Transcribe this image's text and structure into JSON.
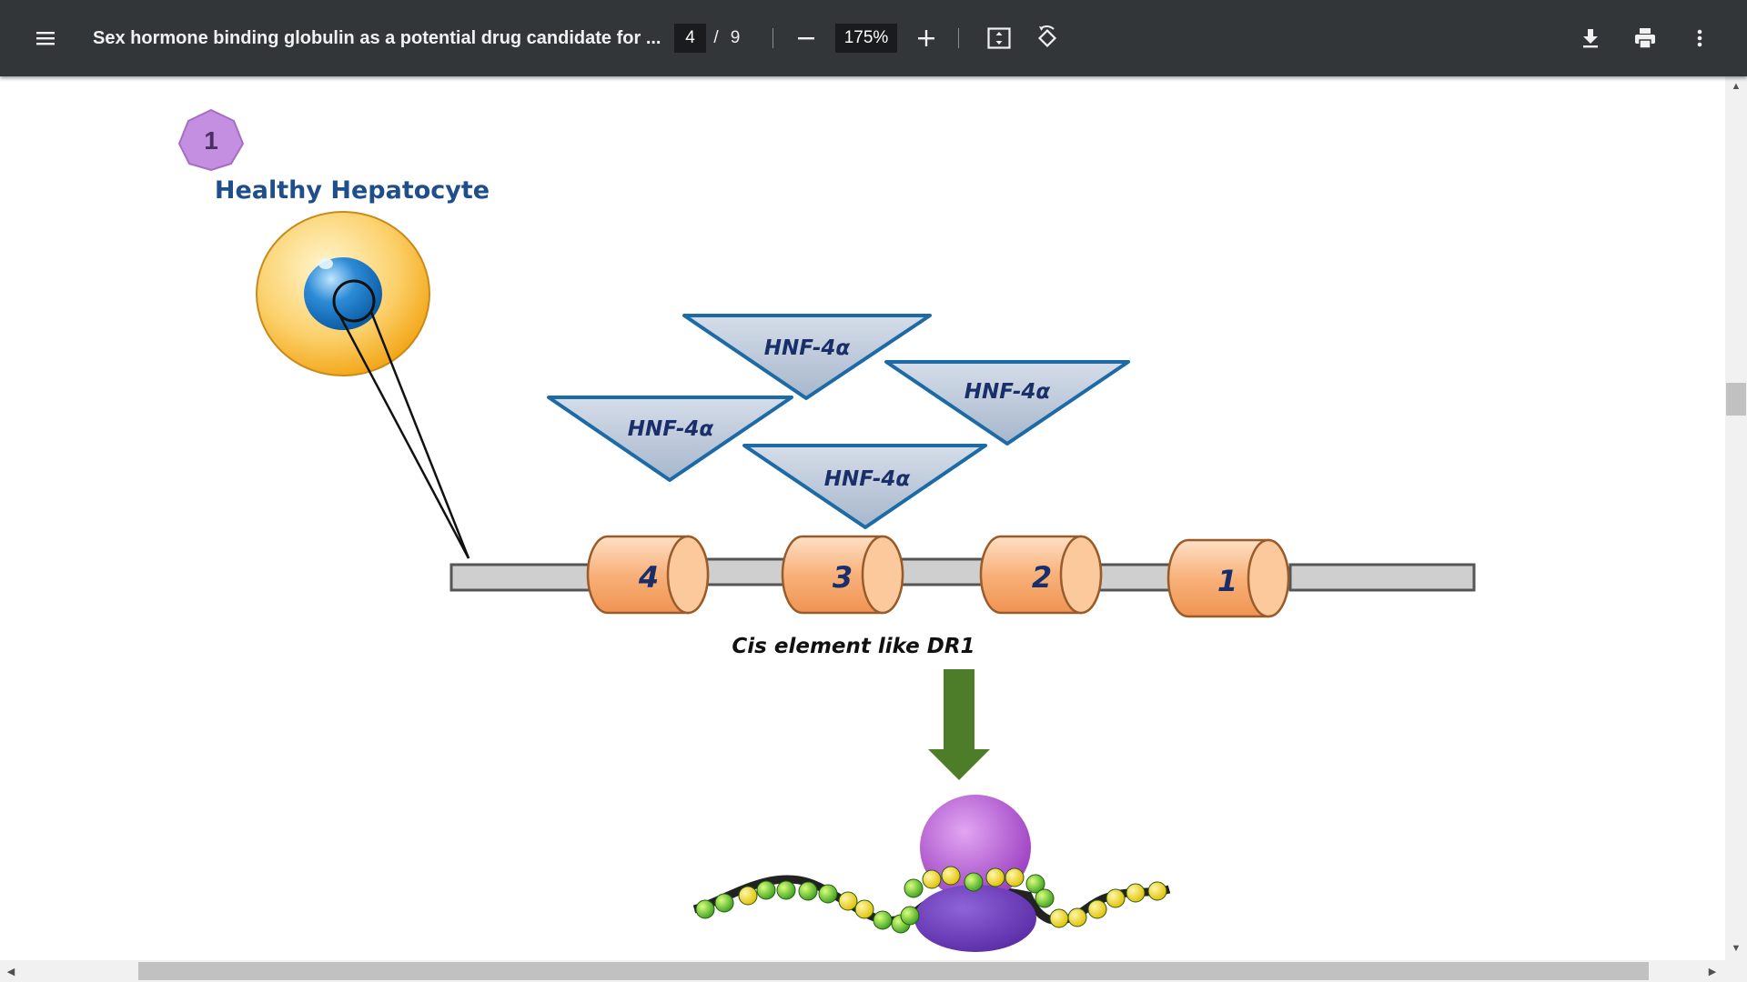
{
  "toolbar": {
    "menu_icon": "hamburger-menu-icon",
    "title": "Sex hormone binding globulin as a potential drug candidate for ...",
    "page_current": "4",
    "page_separator": "/",
    "page_total": "9",
    "zoom": "175%",
    "icons": [
      "zoom-out-icon",
      "zoom-in-icon",
      "fit-to-page-icon",
      "rotate-icon",
      "download-icon",
      "print-icon",
      "more-vert-icon"
    ]
  },
  "figure": {
    "step_badge": "1",
    "cell_label": "Healthy Hepatocyte",
    "transcription_factor_labels": [
      "HNF-4α",
      "HNF-4α",
      "HNF-4α",
      "HNF-4α"
    ],
    "element_numbers": [
      "4",
      "3",
      "2",
      "1"
    ],
    "cis_label": "Cis element like DR1"
  },
  "colors": {
    "toolbar_bg": "#323639",
    "label_blue": "#1f4e8c",
    "badge_purple": "#c48fe0",
    "cylinder_orange": "#f7b98a",
    "arrow_green": "#4e7d2a",
    "ribosome_purple": "#9b4fc4"
  }
}
